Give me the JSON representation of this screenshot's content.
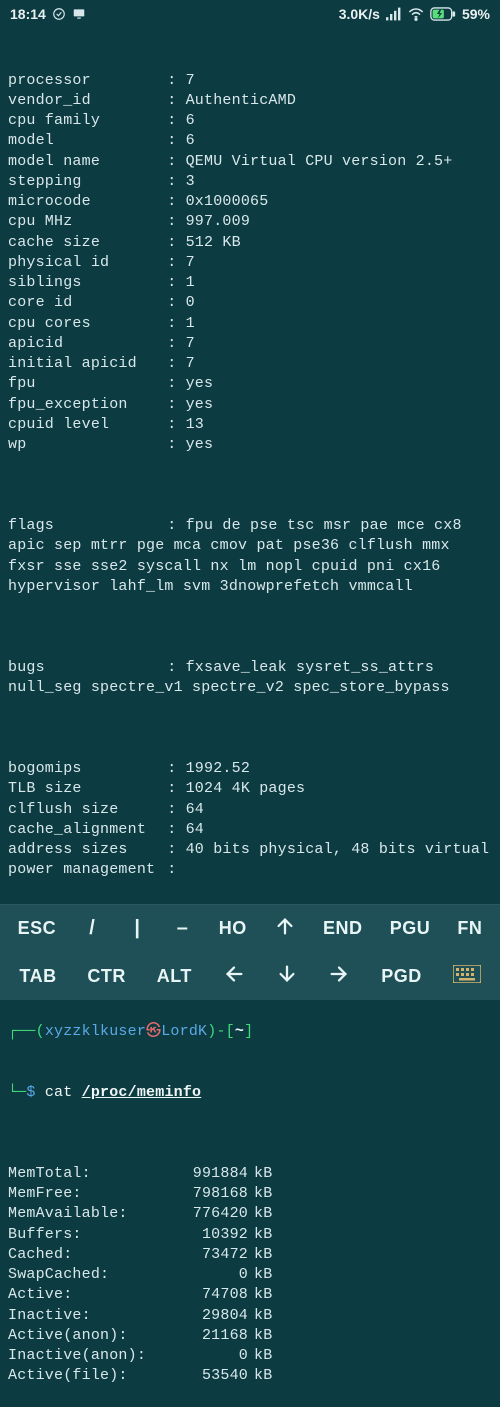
{
  "status": {
    "time": "18:14",
    "net_speed": "3.0K/s",
    "battery_pct": "59%"
  },
  "cpuinfo": [
    {
      "k": "processor",
      "v": "7"
    },
    {
      "k": "vendor_id",
      "v": "AuthenticAMD"
    },
    {
      "k": "cpu family",
      "v": "6"
    },
    {
      "k": "model",
      "v": "6"
    },
    {
      "k": "model name",
      "v": "QEMU Virtual CPU version 2.5+"
    },
    {
      "k": "stepping",
      "v": "3"
    },
    {
      "k": "microcode",
      "v": "0x1000065"
    },
    {
      "k": "cpu MHz",
      "v": "997.009"
    },
    {
      "k": "cache size",
      "v": "512 KB"
    },
    {
      "k": "physical id",
      "v": "7"
    },
    {
      "k": "siblings",
      "v": "1"
    },
    {
      "k": "core id",
      "v": "0"
    },
    {
      "k": "cpu cores",
      "v": "1"
    },
    {
      "k": "apicid",
      "v": "7"
    },
    {
      "k": "initial apicid",
      "v": "7"
    },
    {
      "k": "fpu",
      "v": "yes"
    },
    {
      "k": "fpu_exception",
      "v": "yes"
    },
    {
      "k": "cpuid level",
      "v": "13"
    },
    {
      "k": "wp",
      "v": "yes"
    }
  ],
  "flags_key": "flags",
  "flags_val": "fpu de pse tsc msr pae mce cx8 apic sep mtrr pge mca cmov pat pse36 clflush mmx fxsr sse sse2 syscall nx lm nopl cpuid pni cx16 hypervisor lahf_lm svm 3dnowprefetch vmmcall",
  "bugs_key": "bugs",
  "bugs_val": "fxsave_leak sysret_ss_attrs null_seg spectre_v1 spectre_v2 spec_store_bypass",
  "cpuinfo2": [
    {
      "k": "bogomips",
      "v": "1992.52"
    },
    {
      "k": "TLB size",
      "v": "1024 4K pages"
    },
    {
      "k": "clflush size",
      "v": "64"
    },
    {
      "k": "cache_alignment",
      "v": "64"
    },
    {
      "k": "address sizes",
      "v": "40 bits physical, 48 bits virtual"
    },
    {
      "k": "power management",
      "v": ""
    }
  ],
  "prompt": {
    "l1_a": "┌──(",
    "user": "xyzzklkuser",
    "sep": "㉿",
    "host": "LordK",
    "l1_b": ")-[",
    "path": "~",
    "l1_c": "]",
    "l2_a": "└─",
    "dollar": "$",
    "cmd": "cat",
    "arg": "/proc/meminfo"
  },
  "meminfo": [
    {
      "k": "MemTotal:",
      "v": "991884",
      "u": "kB"
    },
    {
      "k": "MemFree:",
      "v": "798168",
      "u": "kB"
    },
    {
      "k": "MemAvailable:",
      "v": "776420",
      "u": "kB"
    },
    {
      "k": "Buffers:",
      "v": "10392",
      "u": "kB"
    },
    {
      "k": "Cached:",
      "v": "73472",
      "u": "kB"
    },
    {
      "k": "SwapCached:",
      "v": "0",
      "u": "kB"
    },
    {
      "k": "Active:",
      "v": "74708",
      "u": "kB"
    },
    {
      "k": "Inactive:",
      "v": "29804",
      "u": "kB"
    },
    {
      "k": "Active(anon):",
      "v": "21168",
      "u": "kB"
    },
    {
      "k": "Inactive(anon):",
      "v": "0",
      "u": "kB"
    },
    {
      "k": "Active(file):",
      "v": "53540",
      "u": "kB"
    }
  ],
  "keys": {
    "row1": [
      "ESC",
      "/",
      "|",
      "–",
      "HO",
      "↑",
      "END",
      "PGU",
      "FN"
    ],
    "row2": [
      "TAB",
      "CTR",
      "ALT",
      "←",
      "↓",
      "→",
      "PGD"
    ]
  }
}
